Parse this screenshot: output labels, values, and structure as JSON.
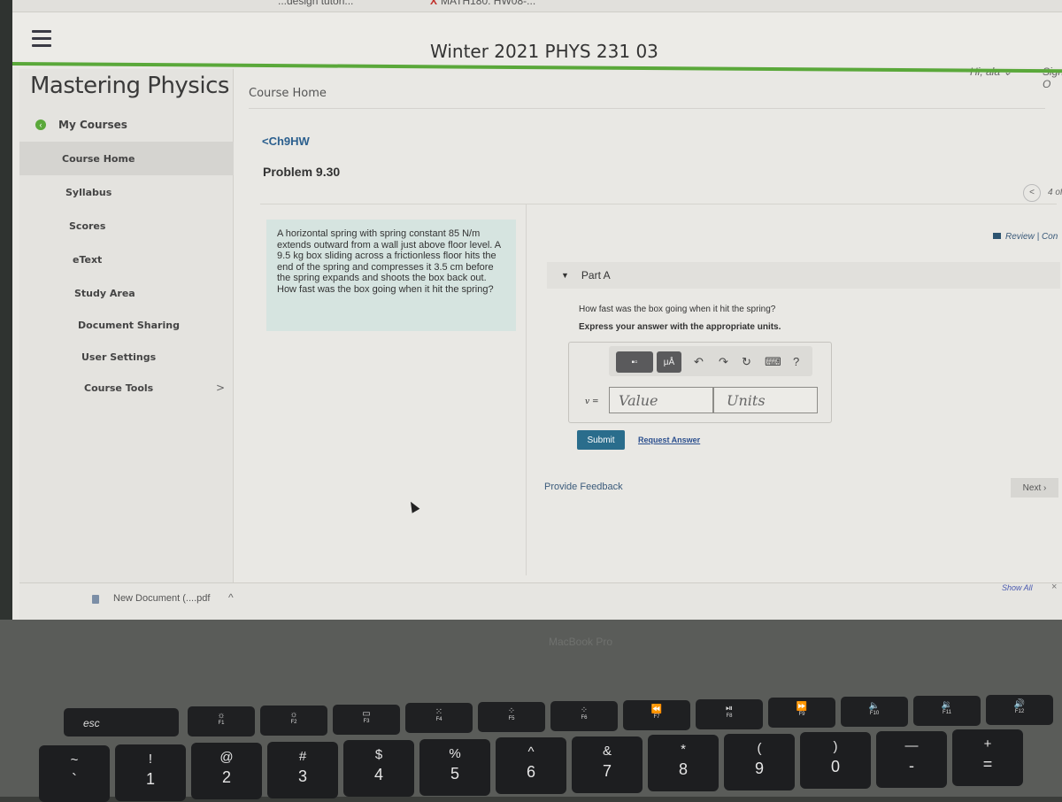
{
  "browser": {
    "tabs": [
      {
        "label": "...design tutori...",
        "icon": "page-icon"
      },
      {
        "label": "MATH180: HW08-...",
        "icon": "x-logo-icon"
      }
    ]
  },
  "header": {
    "course_title": "Winter 2021 PHYS 231 03",
    "user_greeting": "Hi, ala",
    "user_caret": "⌄",
    "sign_out": "Sign O"
  },
  "sidebar": {
    "brand": "Mastering Physics",
    "my_courses": "My Courses",
    "back_glyph": "‹",
    "items": [
      {
        "label": "Course Home",
        "active": true
      },
      {
        "label": "Syllabus"
      },
      {
        "label": "Scores"
      },
      {
        "label": "eText"
      },
      {
        "label": "Study Area"
      },
      {
        "label": "Document Sharing"
      },
      {
        "label": "User Settings"
      },
      {
        "label": "Course Tools",
        "chevron": ">"
      }
    ]
  },
  "main": {
    "breadcrumb": "Course Home",
    "back_link": "<Ch9HW",
    "problem_title": "Problem 9.30",
    "problem_text": "A horizontal spring with spring constant 85 N/m extends outward from a wall just above floor level. A 9.5 kg box sliding across a frictionless floor hits the end of the spring and compresses it 3.5 cm before the spring expands and shoots the box back out. How fast was the box going when it hit the spring?",
    "nav_prev": "<",
    "nav_count": "4 of",
    "review_link": "Review | Con",
    "part": {
      "triangle": "▼",
      "title": "Part A",
      "question": "How fast was the box going when it hit the spring?",
      "instruction": "Express your answer with the appropriate units.",
      "toolbar": {
        "templates": "▪▫",
        "units": "μÅ",
        "undo": "↶",
        "redo": "↷",
        "reset": "↻",
        "keyboard": "⌨",
        "help": "?"
      },
      "variable_label": "v =",
      "value_placeholder": "Value",
      "units_placeholder": "Units",
      "submit": "Submit",
      "request_answer": "Request Answer"
    },
    "feedback": "Provide Feedback",
    "next": "Next ›"
  },
  "downloads": {
    "file_name": "New Document (....pdf",
    "caret": "^",
    "show_all": "Show All",
    "close": "×"
  },
  "laptop": {
    "label": "MacBook Pro",
    "esc": "esc",
    "fkeys": [
      {
        "glyph": "☼",
        "label": "F1"
      },
      {
        "glyph": "☼",
        "label": "F2"
      },
      {
        "glyph": "▭",
        "label": "F3"
      },
      {
        "glyph": "⁙",
        "label": "F4"
      },
      {
        "glyph": "⁘",
        "label": "F5"
      },
      {
        "glyph": "⁘",
        "label": "F6"
      },
      {
        "glyph": "⏪",
        "label": "F7"
      },
      {
        "glyph": "⏯",
        "label": "F8"
      },
      {
        "glyph": "⏩",
        "label": "F9"
      },
      {
        "glyph": "🔈",
        "label": "F10"
      },
      {
        "glyph": "🔉",
        "label": "F11"
      },
      {
        "glyph": "🔊",
        "label": "F12"
      }
    ],
    "keys": [
      {
        "upper": "~",
        "lower": "`"
      },
      {
        "upper": "!",
        "lower": "1"
      },
      {
        "upper": "@",
        "lower": "2"
      },
      {
        "upper": "#",
        "lower": "3"
      },
      {
        "upper": "$",
        "lower": "4"
      },
      {
        "upper": "%",
        "lower": "5"
      },
      {
        "upper": "^",
        "lower": "6"
      },
      {
        "upper": "&",
        "lower": "7"
      },
      {
        "upper": "*",
        "lower": "8"
      },
      {
        "upper": "(",
        "lower": "9"
      },
      {
        "upper": ")",
        "lower": "0"
      },
      {
        "upper": "—",
        "lower": "-"
      },
      {
        "upper": "+",
        "lower": "="
      }
    ]
  }
}
